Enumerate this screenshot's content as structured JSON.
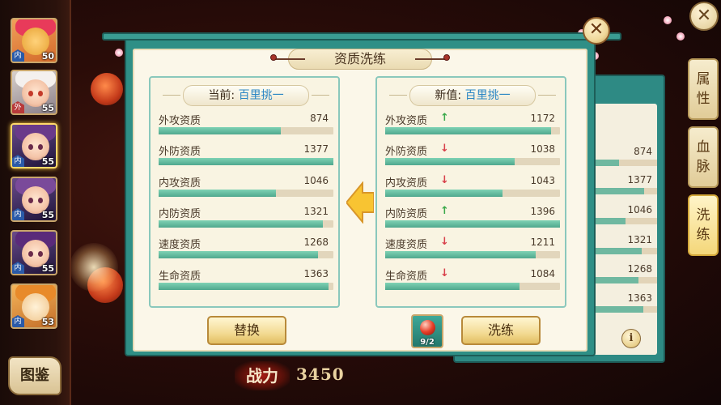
{
  "dialog": {
    "title": "资质洗练",
    "close_icon": "✕"
  },
  "current_panel": {
    "prefix": "当前:",
    "value": "百里挑一",
    "stats": [
      {
        "name": "外攻资质",
        "value": "874",
        "fill": 0.7
      },
      {
        "name": "外防资质",
        "value": "1377",
        "fill": 1.0
      },
      {
        "name": "内攻资质",
        "value": "1046",
        "fill": 0.67
      },
      {
        "name": "内防资质",
        "value": "1321",
        "fill": 0.94
      },
      {
        "name": "速度资质",
        "value": "1268",
        "fill": 0.91
      },
      {
        "name": "生命资质",
        "value": "1363",
        "fill": 0.97
      }
    ]
  },
  "new_panel": {
    "prefix": "新值:",
    "value": "百里挑一",
    "stats": [
      {
        "name": "外攻资质",
        "value": "1172",
        "trend": "up",
        "fill": 0.95
      },
      {
        "name": "外防资质",
        "value": "1038",
        "trend": "down",
        "fill": 0.74
      },
      {
        "name": "内攻资质",
        "value": "1043",
        "trend": "down",
        "fill": 0.67
      },
      {
        "name": "内防资质",
        "value": "1396",
        "trend": "up",
        "fill": 1.0
      },
      {
        "name": "速度资质",
        "value": "1211",
        "trend": "down",
        "fill": 0.86
      },
      {
        "name": "生命资质",
        "value": "1084",
        "trend": "down",
        "fill": 0.77
      }
    ]
  },
  "buttons": {
    "replace": "替换",
    "refine": "洗练"
  },
  "item": {
    "count": "9/2",
    "icon": "red-gem-icon"
  },
  "power": {
    "label": "战力",
    "value": "3450"
  },
  "side_tabs": [
    {
      "label_1": "属",
      "label_2": "性"
    },
    {
      "label_1": "血",
      "label_2": "脉"
    },
    {
      "label_1": "洗",
      "label_2": "练"
    }
  ],
  "corner_close": "✕",
  "codex": "图鉴",
  "heroes": [
    {
      "level": "50",
      "tag": "内"
    },
    {
      "level": "55",
      "tag": "外"
    },
    {
      "level": "55",
      "tag": "内"
    },
    {
      "level": "55",
      "tag": "内"
    },
    {
      "level": "55",
      "tag": "内"
    },
    {
      "level": "53",
      "tag": "内"
    }
  ],
  "background_values": [
    "874",
    "1377",
    "1046",
    "1321",
    "1268",
    "1363"
  ],
  "info_icon": "i",
  "colors": {
    "frame": "#2f8f86",
    "paper": "#fbf7e9",
    "bar_fill": "#4fa88e",
    "up": "#3aa84a",
    "down": "#d8404a",
    "highlight": "#2a86c4"
  }
}
